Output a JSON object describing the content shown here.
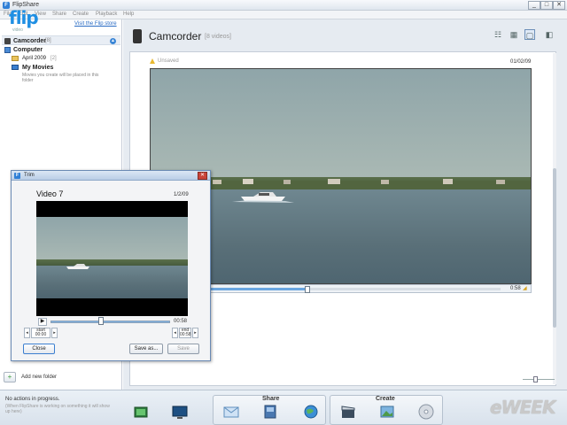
{
  "window": {
    "title": "FlipShare",
    "app_icon_glyph": "F",
    "buttons": [
      "_",
      "□",
      "✕"
    ]
  },
  "menu": [
    "File",
    "Edit",
    "View",
    "Share",
    "Create",
    "Playback",
    "Help"
  ],
  "sidebar": {
    "logo": "flip",
    "logo_sub": "video",
    "store_link": "Visit the Flip store",
    "camcorder": {
      "label": "Camcorder",
      "count": "[8]"
    },
    "computer": {
      "label": "Computer"
    },
    "folders": [
      {
        "label": "April 2009",
        "count": "[2]"
      },
      {
        "label": "My Movies",
        "description": "Movies you create will be placed in this folder"
      }
    ],
    "add_folder": "Add new folder"
  },
  "main": {
    "title": "Camcorder",
    "count": "[8 videos]",
    "unsaved": "Unsaved",
    "date": "01/02/09",
    "duration": "0:58",
    "view_buttons": [
      "details-view",
      "list-view",
      "filmstrip-view",
      "fullscreen-view"
    ]
  },
  "trim": {
    "title": "Trim",
    "icon_glyph": "F",
    "close_glyph": "✕",
    "video_title": "Video 7",
    "date": "1/2/09",
    "duration": "00:58",
    "start_label": "start",
    "start_time": "00:00",
    "end_label": "end",
    "end_time": "00:58",
    "buttons": {
      "close": "Close",
      "save_as": "Save as...",
      "save": "Save"
    }
  },
  "status": {
    "text": "No actions in progress.",
    "sub": "(When FlipShare is working on something it will show up here)"
  },
  "toolbar": {
    "share_label": "Share",
    "create_label": "Create"
  },
  "watermark": "eWEEK",
  "colors": {
    "accent": "#1f8fe3",
    "highlight_bg": "#e9eef5",
    "main_bg": "#e6ebf1"
  }
}
